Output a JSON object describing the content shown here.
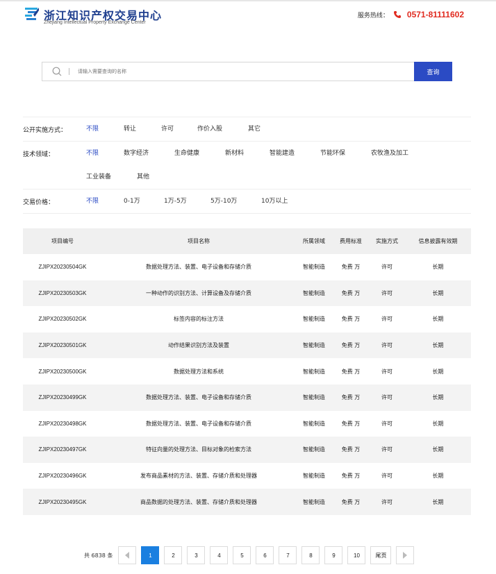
{
  "header": {
    "logo_title": "浙江知识产权交易中心",
    "logo_subtitle": "Zhejiang Intellectual Property Exchange Center",
    "hotline_label": "服务热线：",
    "hotline_number": "0571-81111602",
    "icons": {
      "logo": "logo-mark-icon",
      "phone": "phone-icon"
    }
  },
  "search": {
    "placeholder": "请输入需要查询的名称",
    "button_label": "查询",
    "icon": "search-icon"
  },
  "filters": [
    {
      "label": "公开实施方式：",
      "options": [
        "不限",
        "转让",
        "许可",
        "作价入股",
        "其它"
      ],
      "selected": "不限"
    },
    {
      "label": "技术领域：",
      "options": [
        "不限",
        "数字经济",
        "生命健康",
        "新材料",
        "智能建造",
        "节能环保",
        "农牧渔及加工",
        "工业装备",
        "其他"
      ],
      "selected": "不限"
    },
    {
      "label": "交易价格：",
      "options": [
        "不限",
        "0-1万",
        "1万-5万",
        "5万-10万",
        "10万以上"
      ],
      "selected": "不限"
    }
  ],
  "table": {
    "columns": [
      "项目编号",
      "项目名称",
      "所属领域",
      "费用标准",
      "实施方式",
      "信息披露有效期"
    ],
    "rows": [
      [
        "ZJIPX20230504GK",
        "数据处理方法、装置、电子设备和存储介质",
        "智能制造",
        "免费 万",
        "许可",
        "长期"
      ],
      [
        "ZJIPX20230503GK",
        "一种动作的识别方法、计算设备及存储介质",
        "智能制造",
        "免费 万",
        "许可",
        "长期"
      ],
      [
        "ZJIPX20230502GK",
        "标签内容的标注方法",
        "智能制造",
        "免费 万",
        "许可",
        "长期"
      ],
      [
        "ZJIPX20230501GK",
        "动作结果识别方法及装置",
        "智能制造",
        "免费 万",
        "许可",
        "长期"
      ],
      [
        "ZJIPX20230500GK",
        "数据处理方法和系统",
        "智能制造",
        "免费 万",
        "许可",
        "长期"
      ],
      [
        "ZJIPX20230499GK",
        "数据处理方法、装置、电子设备和存储介质",
        "智能制造",
        "免费 万",
        "许可",
        "长期"
      ],
      [
        "ZJIPX20230498GK",
        "数据处理方法、装置、电子设备和存储介质",
        "智能制造",
        "免费 万",
        "许可",
        "长期"
      ],
      [
        "ZJIPX20230497GK",
        "特征向量的处理方法、目标对象的检索方法",
        "智能制造",
        "免费 万",
        "许可",
        "长期"
      ],
      [
        "ZJIPX20230496GK",
        "发布商品素材的方法、装置、存储介质和处理器",
        "智能制造",
        "免费 万",
        "许可",
        "长期"
      ],
      [
        "ZJIPX20230495GK",
        "商品数据的处理方法、装置、存储介质和处理器",
        "智能制造",
        "免费 万",
        "许可",
        "长期"
      ]
    ]
  },
  "pagination": {
    "total_label": "共 6838 条",
    "pages": [
      "1",
      "2",
      "3",
      "4",
      "5",
      "6",
      "7",
      "8",
      "9",
      "10"
    ],
    "current": "1",
    "last_label": "尾页"
  },
  "colors": {
    "accent": "#2b4bc4",
    "active_page": "#1a7fe0",
    "hotline": "#e02b20",
    "logo_blue": "#1f3f8f"
  }
}
